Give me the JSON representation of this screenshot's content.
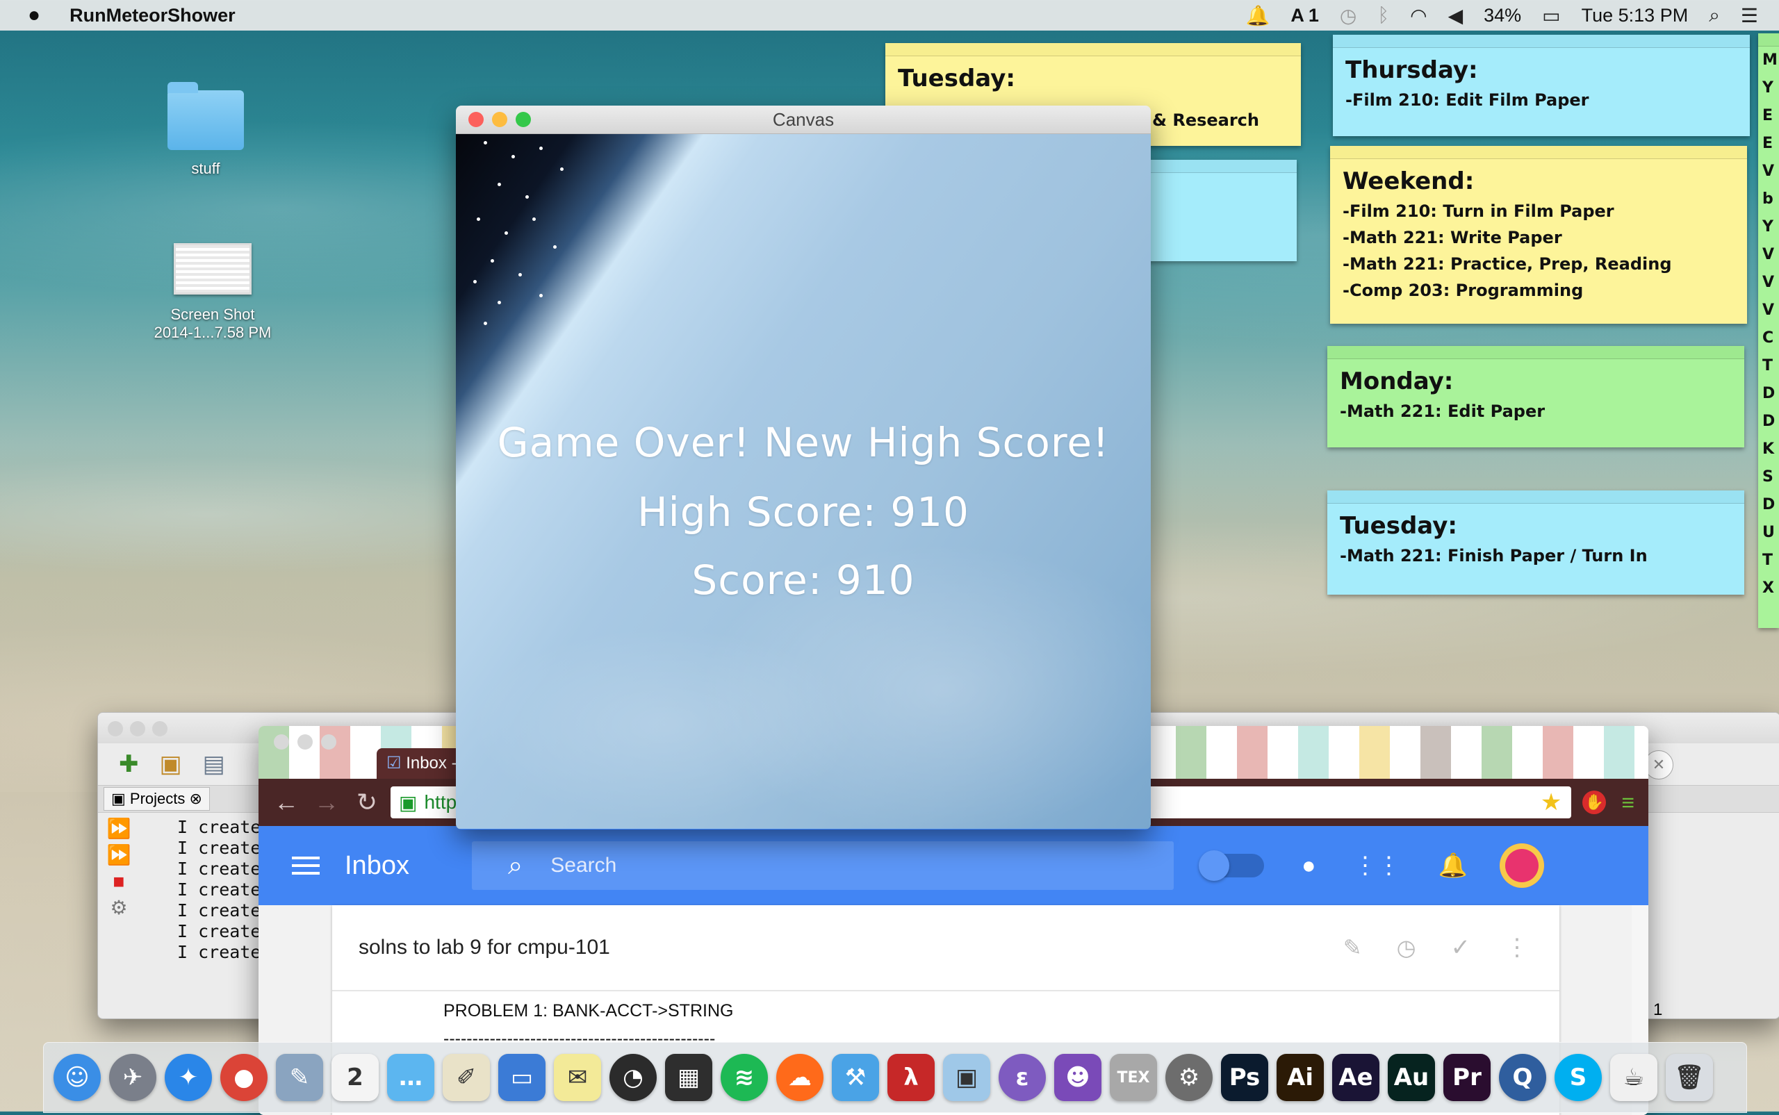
{
  "menubar": {
    "app_name": "RunMeteorShower",
    "battery": "34%",
    "clock": "Tue 5:13 PM",
    "notifications_count": "1"
  },
  "desktop": {
    "folder_label": "stuff",
    "screenshot_label_1": "Screen Shot",
    "screenshot_label_2": "2014-1...7.58 PM"
  },
  "stickies": {
    "tuesday_top": {
      "title": "Tuesday:",
      "line": "s & Research"
    },
    "thursday": {
      "title": "Thursday:",
      "lines": [
        "-Film 210: Edit Film Paper"
      ]
    },
    "weekend": {
      "title": "Weekend:",
      "lines": [
        "-Film 210: Turn in Film Paper",
        "-Math 221: Write Paper",
        "-Math 221: Practice, Prep, Reading",
        "-Comp 203: Programming"
      ]
    },
    "monday": {
      "title": "Monday:",
      "lines": [
        "-Math 221: Edit Paper"
      ]
    },
    "tuesday": {
      "title": "Tuesday:",
      "lines": [
        "-Math 221: Finish Paper / Turn In"
      ]
    },
    "edge_letters": [
      "M",
      "Y",
      "E",
      "E",
      "V",
      "b",
      "Y",
      "V",
      "V",
      "V",
      "C",
      "T",
      "D",
      "D",
      "K",
      "S",
      "D",
      "U",
      "T",
      "X"
    ]
  },
  "canvas_window": {
    "title": "Canvas",
    "line1": "Game Over! New High Score!",
    "line2": "High Score: 910",
    "line3": "Score: 910"
  },
  "ide": {
    "projects_tab": "Projects",
    "console_lines": [
      "I create",
      "I create",
      "I create",
      "I create",
      "I create",
      "I create",
      "I create"
    ],
    "line_number": "1"
  },
  "browser": {
    "tab_title": "Inbox -",
    "url_fragment": "http",
    "inbox_title": "Inbox",
    "search_placeholder": "Search",
    "email_subject": "solns to lab 9 for cmpu-101",
    "email_line1": "PROBLEM 1:  BANK-ACCT->STRING",
    "email_line2": "-----------------------------------------------"
  },
  "dock": {
    "apps": [
      {
        "name": "Finder",
        "glyph": "☺",
        "color": "#3a8ee6"
      },
      {
        "name": "Launchpad",
        "glyph": "✈",
        "color": "#7a7f8a"
      },
      {
        "name": "Safari",
        "glyph": "✦",
        "color": "#2a86e8"
      },
      {
        "name": "Chrome",
        "glyph": "●",
        "color": "#db4437"
      },
      {
        "name": "Preview",
        "glyph": "✎",
        "color": "#8aa4c0"
      },
      {
        "name": "Calendar",
        "glyph": "2",
        "color": "#f4f4f4"
      },
      {
        "name": "Messages",
        "glyph": "…",
        "color": "#5cb6f0"
      },
      {
        "name": "TextEdit",
        "glyph": "✐",
        "color": "#e9e2c8"
      },
      {
        "name": "Keynote",
        "glyph": "▭",
        "color": "#3b7bd6"
      },
      {
        "name": "Stickies",
        "glyph": "✉",
        "color": "#f3ea98"
      },
      {
        "name": "Dashboard",
        "glyph": "◔",
        "color": "#2b2b2b"
      },
      {
        "name": "Photo Booth",
        "glyph": "▦",
        "color": "#2e2e2e"
      },
      {
        "name": "Spotify",
        "glyph": "≋",
        "color": "#1db954"
      },
      {
        "name": "SoundCloud",
        "glyph": "☁",
        "color": "#ff6a1a"
      },
      {
        "name": "Xcode",
        "glyph": "⚒",
        "color": "#4aa3e6"
      },
      {
        "name": "DrRacket",
        "glyph": "λ",
        "color": "#c62828"
      },
      {
        "name": "VirtualBox",
        "glyph": "▣",
        "color": "#9fc8e8"
      },
      {
        "name": "Emacs",
        "glyph": "ε",
        "color": "#7e5bc0"
      },
      {
        "name": "GitHub",
        "glyph": "☻",
        "color": "#7a4ab8"
      },
      {
        "name": "TeX",
        "glyph": "TEX",
        "color": "#a8a8a8"
      },
      {
        "name": "System Preferences",
        "glyph": "⚙",
        "color": "#6d6d6d"
      },
      {
        "name": "Photoshop",
        "glyph": "Ps",
        "color": "#0b1b2e"
      },
      {
        "name": "Illustrator",
        "glyph": "Ai",
        "color": "#2b1a06"
      },
      {
        "name": "After Effects",
        "glyph": "Ae",
        "color": "#1a1435"
      },
      {
        "name": "Audition",
        "glyph": "Au",
        "color": "#06231f"
      },
      {
        "name": "Premiere",
        "glyph": "Pr",
        "color": "#2a0d2f"
      },
      {
        "name": "QuickTime",
        "glyph": "Q",
        "color": "#2f5e9e"
      },
      {
        "name": "Skype",
        "glyph": "S",
        "color": "#00aff0"
      },
      {
        "name": "Java",
        "glyph": "☕",
        "color": "#f0f0f0"
      },
      {
        "name": "Trash",
        "glyph": "🗑",
        "color": "#d9dde2"
      }
    ]
  }
}
